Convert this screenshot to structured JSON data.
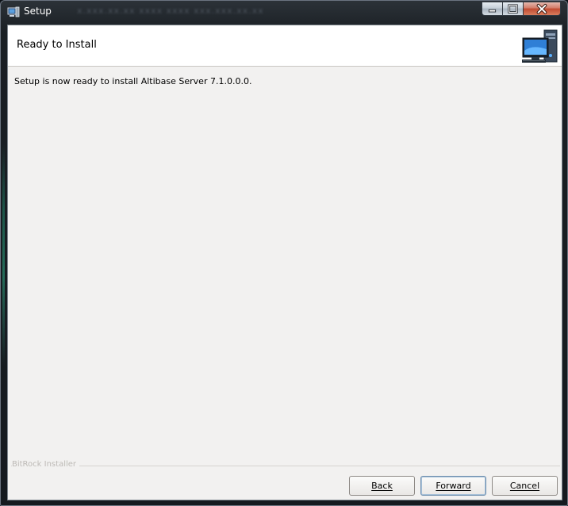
{
  "window": {
    "title": "Setup",
    "title_obscured": "x.xxx.xx.xx  xxxx  xxxx  xxx.xxx.xx.xx",
    "controls": {
      "minimize": "minimize",
      "maximize": "maximize",
      "close": "close"
    }
  },
  "header": {
    "title": "Ready to Install",
    "image": "computer-icon"
  },
  "main": {
    "message": "Setup is now ready to install Altibase Server 7.1.0.0.0."
  },
  "footer": {
    "brand": "BitRock Installer",
    "buttons": {
      "back": "Back",
      "forward": "Forward",
      "cancel": "Cancel"
    }
  },
  "colors": {
    "panel": "#f2f1f0",
    "header_bg": "#ffffff",
    "focus_border": "#6f8fae",
    "close_red": "#c04a31"
  }
}
